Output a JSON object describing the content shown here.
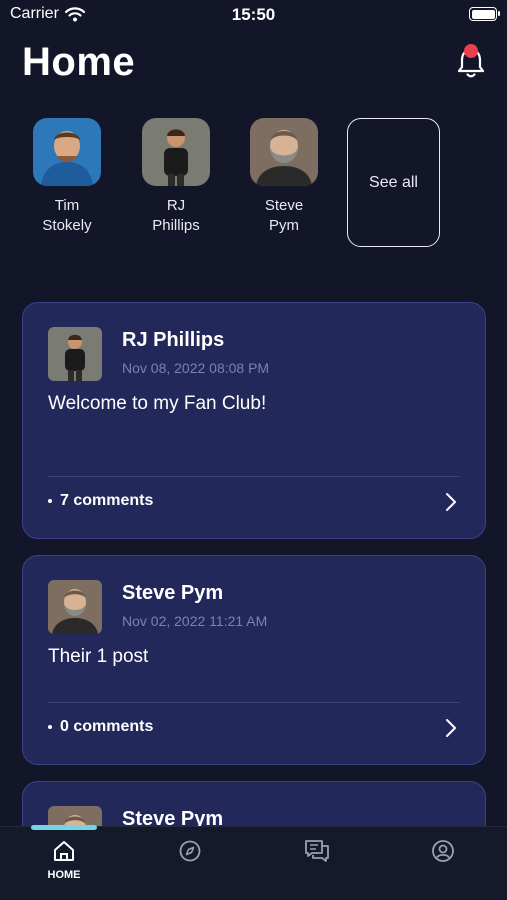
{
  "status_bar": {
    "carrier": "Carrier",
    "time": "15:50"
  },
  "header": {
    "title": "Home"
  },
  "stories": {
    "people": [
      {
        "name": "Tim\nStokely",
        "shirt": "#1f5c9e",
        "bg": "#2d78b8"
      },
      {
        "name": "RJ\nPhillips",
        "shirt": "#1b1b1b",
        "bg": "#7a7c74"
      },
      {
        "name": "Steve\nPym",
        "shirt": "#2a2a2a",
        "bg": "#7e6e62"
      }
    ],
    "see_all": "See all"
  },
  "posts": [
    {
      "author": "RJ Phillips",
      "date": "Nov 08, 2022 08:08 PM",
      "body": "Welcome to my Fan Club!",
      "comments": "7 comments"
    },
    {
      "author": "Steve Pym",
      "date": "Nov 02, 2022 11:21 AM",
      "body": "Their 1 post",
      "comments": "0 comments"
    },
    {
      "author": "Steve Pym"
    }
  ],
  "tabbar": {
    "home_label": "HOME"
  },
  "colors": {
    "background": "#121628",
    "card": "#22285a",
    "accent": "#74d3e6",
    "notification": "#e8404f"
  }
}
